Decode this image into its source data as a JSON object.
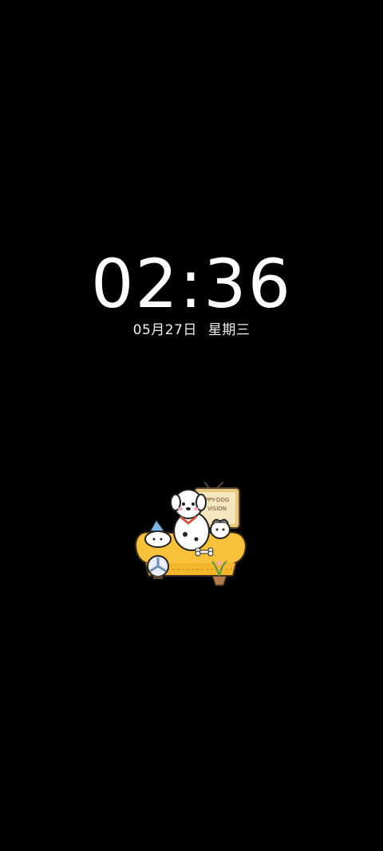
{
  "lockscreen": {
    "time": "02:36",
    "date": "05月27日",
    "weekday": "星期三"
  },
  "illustration": {
    "icon": "dog-sofa-illustration",
    "tv_text": "PPY-DOG VISION"
  },
  "colors": {
    "background": "#000000",
    "text": "#ffffff",
    "sofa": "#f7c23a",
    "tv": "#e8c87c"
  }
}
